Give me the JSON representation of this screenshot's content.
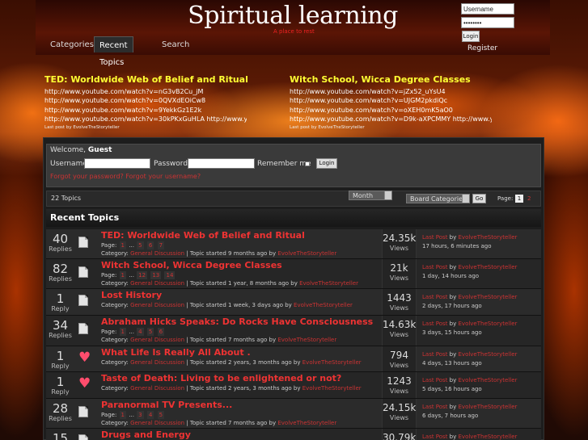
{
  "site": {
    "title": "Spiritual learning",
    "tagline": "A place to rest"
  },
  "login": {
    "username_value": "Username",
    "password_value": "••••••••",
    "login_label": "Login",
    "register_label": "Register"
  },
  "nav": {
    "tabs": [
      {
        "label": "Categories"
      },
      {
        "label": "Recent Topics",
        "active": true
      },
      {
        "label": "Search"
      }
    ]
  },
  "feeds": [
    {
      "title": "TED: Worldwide Web of Belief and Ritual",
      "lines": [
        "http://www.youtube.com/watch?v=nG3vB2Cu_jM",
        "http://www.youtube.com/watch?v=0QVXdEOiCw8",
        "http://www.youtube.com/watch?v=9YekkGz1E2k",
        "http://www.youtube.com/watch?v=30kPKxGuHLA http://www.you"
      ],
      "meta_prefix": "Last post by",
      "meta_author": "EvolveTheStoryteller"
    },
    {
      "title": "Witch School, Wicca Degree Classes",
      "lines": [
        "http://www.youtube.com/watch?v=jZx52_uYsU4",
        "http://www.youtube.com/watch?v=UJGM2pkdiQc",
        "http://www.youtube.com/watch?v=oXEH0mK5aO0",
        "http://www.youtube.com/watch?v=D9k-aXPCMMY http://www.youtu"
      ],
      "meta_prefix": "Last post by",
      "meta_author": "EvolveTheStoryteller"
    }
  ],
  "welcome": {
    "prefix": "Welcome,",
    "name": "Guest",
    "username_label": "Username:",
    "password_label": "Password:",
    "remember_label": "Remember me",
    "login_label": "Login",
    "forgot_text": "Forgot your password? Forgot your username?"
  },
  "toolbar": {
    "topic_count": "22 Topics",
    "sort_value": "Month",
    "category_value": "Board Categories",
    "go_label": "Go",
    "page_label": "Page:",
    "current_page": "1",
    "next_page": "2"
  },
  "section": {
    "title": "Recent Topics"
  },
  "topics": [
    {
      "replies": "40",
      "replies_label": "Replies",
      "icon": "document-icon",
      "title": "TED: Worldwide Web of Belief and Ritual",
      "page_prefix": "Page:",
      "pages": [
        "1",
        "...",
        "5",
        "6",
        "7"
      ],
      "category_prefix": "Category:",
      "category": "General Discussion",
      "started_text": " | Topic started 9 months ago by ",
      "author": "EvolveTheStoryteller",
      "views": "24.35k",
      "views_label": "Views",
      "last_prefix": "Last Post",
      "last_by": " by ",
      "last_author": "EvolveTheStoryteller",
      "last_time": "17 hours, 6 minutes ago"
    },
    {
      "replies": "82",
      "replies_label": "Replies",
      "icon": "document-icon",
      "title": "Witch School, Wicca Degree Classes",
      "page_prefix": "Page:",
      "pages": [
        "1",
        "...",
        "12",
        "13",
        "14"
      ],
      "category_prefix": "Category:",
      "category": "General Discussion",
      "started_text": " | Topic started 1 year, 8 months ago by ",
      "author": "EvolveTheStoryteller",
      "views": "21k",
      "views_label": "Views",
      "last_prefix": "Last Post",
      "last_by": " by ",
      "last_author": "EvolveTheStoryteller",
      "last_time": "1 day, 14 hours ago"
    },
    {
      "replies": "1",
      "replies_label": "Reply",
      "icon": "document-icon",
      "title": "Lost History",
      "page_prefix": "",
      "pages": [],
      "category_prefix": "Category:",
      "category": "General Discussion",
      "started_text": " | Topic started 1 week, 3 days ago by ",
      "author": "EvolveTheStoryteller",
      "views": "1443",
      "views_label": "Views",
      "last_prefix": "Last Post",
      "last_by": " by ",
      "last_author": "EvolveTheStoryteller",
      "last_time": "2 days, 17 hours ago"
    },
    {
      "replies": "34",
      "replies_label": "Replies",
      "icon": "document-icon",
      "title": "Abraham Hicks Speaks: Do Rocks Have Consciousness",
      "page_prefix": "Page:",
      "pages": [
        "1",
        "...",
        "4",
        "5",
        "6"
      ],
      "category_prefix": "Category:",
      "category": "General Discussion",
      "started_text": " | Topic started 7 months ago by ",
      "author": "EvolveTheStoryteller",
      "views": "14.63k",
      "views_label": "Views",
      "last_prefix": "Last Post",
      "last_by": " by ",
      "last_author": "EvolveTheStoryteller",
      "last_time": "3 days, 15 hours ago"
    },
    {
      "replies": "1",
      "replies_label": "Reply",
      "icon": "heart-icon",
      "title": "What Life Is Really All About .",
      "page_prefix": "",
      "pages": [],
      "category_prefix": "Category:",
      "category": "General Discussion",
      "started_text": " | Topic started 2 years, 3 months ago by ",
      "author": "EvolveTheStoryteller",
      "views": "794",
      "views_label": "Views",
      "last_prefix": "Last Post",
      "last_by": " by ",
      "last_author": "EvolveTheStoryteller",
      "last_time": "4 days, 13 hours ago"
    },
    {
      "replies": "1",
      "replies_label": "Reply",
      "icon": "heart-icon",
      "title": "Taste of Death: Living to be enlightened or not?",
      "page_prefix": "",
      "pages": [],
      "category_prefix": "Category:",
      "category": "General Discussion",
      "started_text": " | Topic started 2 years, 3 months ago by ",
      "author": "EvolveTheStoryteller",
      "views": "1243",
      "views_label": "Views",
      "last_prefix": "Last Post",
      "last_by": " by ",
      "last_author": "EvolveTheStoryteller",
      "last_time": "5 days, 16 hours ago"
    },
    {
      "replies": "28",
      "replies_label": "Replies",
      "icon": "document-icon",
      "title": "Paranormal TV Presents...",
      "page_prefix": "Page:",
      "pages": [
        "1",
        "...",
        "3",
        "4",
        "5"
      ],
      "category_prefix": "Category:",
      "category": "General Discussion",
      "started_text": " | Topic started 7 months ago by ",
      "author": "EvolveTheStoryteller",
      "views": "24.15k",
      "views_label": "Views",
      "last_prefix": "Last Post",
      "last_by": " by ",
      "last_author": "EvolveTheStoryteller",
      "last_time": "6 days, 7 hours ago"
    },
    {
      "replies": "15",
      "replies_label": "Replies",
      "icon": "document-icon",
      "title": "Drugs and Energy",
      "page_prefix": "",
      "pages": [],
      "category_prefix": "",
      "category": "",
      "started_text": "",
      "author": "",
      "views": "30.79k",
      "views_label": "",
      "last_prefix": "Last Post",
      "last_by": " by ",
      "last_author": "EvolveTheStoryteller",
      "last_time": ""
    }
  ]
}
